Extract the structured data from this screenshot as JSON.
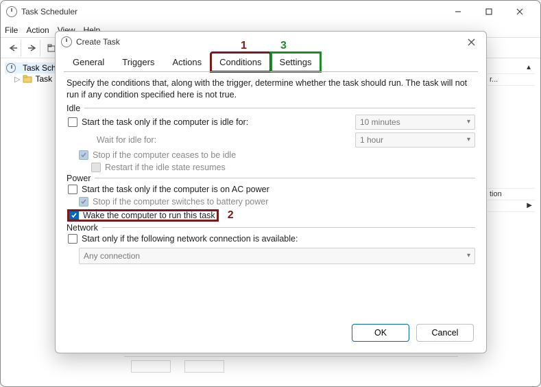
{
  "main": {
    "title": "Task Scheduler",
    "menus": [
      "File",
      "Action",
      "View",
      "Help"
    ],
    "tree": {
      "root": "Task Sche",
      "child": "Task S"
    },
    "right": {
      "item": "tion",
      "item2": "r..."
    }
  },
  "dialog": {
    "title": "Create Task",
    "tabs": {
      "general": "General",
      "triggers": "Triggers",
      "actions": "Actions",
      "conditions": "Conditions",
      "settings": "Settings"
    },
    "annotations": {
      "one": "1",
      "two": "2",
      "three": "3"
    },
    "conditions": {
      "description": "Specify the conditions that, along with the trigger, determine whether the task should run.  The task will not run  if any condition specified here is not true.",
      "idle": {
        "group": "Idle",
        "start_label": "Start the task only if the computer is idle for:",
        "start_value": "10 minutes",
        "wait_label": "Wait for idle for:",
        "wait_value": "1 hour",
        "stop_label": "Stop if the computer ceases to be idle",
        "restart_label": "Restart if the idle state resumes"
      },
      "power": {
        "group": "Power",
        "ac_label": "Start the task only if the computer is on AC power",
        "stop_bat_label": "Stop if the computer switches to battery power",
        "wake_label": "Wake the computer to run this task"
      },
      "network": {
        "group": "Network",
        "start_label": "Start only if the following network connection is available:",
        "value": "Any connection"
      }
    },
    "buttons": {
      "ok": "OK",
      "cancel": "Cancel"
    }
  }
}
